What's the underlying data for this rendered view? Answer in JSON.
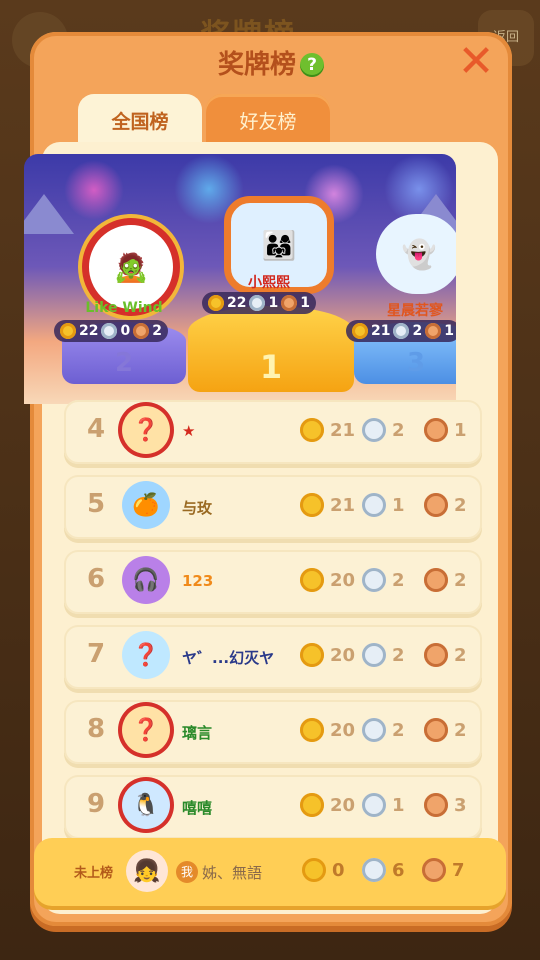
{
  "background": {
    "title": "奖牌榜",
    "back_label": "返回"
  },
  "header": {
    "title": "奖牌榜",
    "help_icon": "?",
    "close_icon": "✕"
  },
  "tabs": [
    {
      "label": "全国榜",
      "active": true
    },
    {
      "label": "好友榜",
      "active": false
    }
  ],
  "top3": [
    {
      "rank": "2",
      "name": "Like Wind",
      "gold": "22",
      "silver": "0",
      "bronze": "2"
    },
    {
      "rank": "1",
      "name": "小熙熙",
      "gold": "22",
      "silver": "1",
      "bronze": "1"
    },
    {
      "rank": "3",
      "name": "星晨若寥",
      "gold": "21",
      "silver": "2",
      "bronze": "1"
    }
  ],
  "rows": [
    {
      "rank": "4",
      "name": "★",
      "name_color": "#d42a1e",
      "gold": "21",
      "silver": "2",
      "bronze": "1"
    },
    {
      "rank": "5",
      "name": "与玫",
      "name_color": "#9a6a22",
      "gold": "21",
      "silver": "1",
      "bronze": "2"
    },
    {
      "rank": "6",
      "name": "123",
      "name_color": "#f08a1a",
      "gold": "20",
      "silver": "2",
      "bronze": "2"
    },
    {
      "rank": "7",
      "name": "ヤ゛...幻灭ヤ",
      "name_color": "#2a3a8a",
      "gold": "20",
      "silver": "2",
      "bronze": "2"
    },
    {
      "rank": "8",
      "name": "璃言",
      "name_color": "#2a8a2a",
      "gold": "20",
      "silver": "2",
      "bronze": "2"
    },
    {
      "rank": "9",
      "name": "嘻嘻",
      "name_color": "#2a8a2a",
      "gold": "20",
      "silver": "1",
      "bronze": "3"
    }
  ],
  "self": {
    "status": "未上榜",
    "badge": "我",
    "name": "姊、無語",
    "gold": "0",
    "silver": "6",
    "bronze": "7"
  },
  "colors": {
    "panel": "#f4a45a",
    "inner": "#fdf0d0",
    "gold": "#f6c22a",
    "silver": "#e6eef6",
    "bronze": "#f0a46a"
  }
}
